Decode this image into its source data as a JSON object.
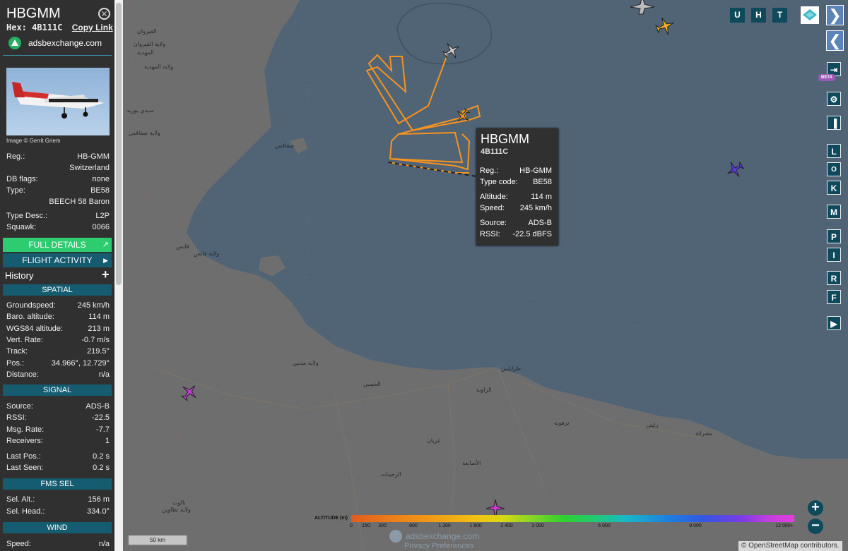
{
  "sidebar": {
    "callsign": "HBGMM",
    "close_glyph": "⨯",
    "hex_label": "Hex:",
    "hex_value": "4B111C",
    "copy_link": "Copy Link",
    "brand": "adsbexchange.com",
    "photo_credit": "Image © Gerrit Griem",
    "reg_label": "Reg.:",
    "reg_value": "HB-GMM",
    "country": "Switzerland",
    "dbflags_label": "DB flags:",
    "dbflags_value": "none",
    "type_label": "Type:",
    "type_value": "BE58",
    "type_name": "BEECH 58 Baron",
    "typedesc_label": "Type Desc.:",
    "typedesc_value": "L2P",
    "squawk_label": "Squawk:",
    "squawk_value": "0066",
    "full_details": "FULL DETAILS",
    "flight_activity": "FLIGHT ACTIVITY",
    "history": "History",
    "spatial": {
      "title": "SPATIAL",
      "rows": [
        {
          "label": "Groundspeed:",
          "value": "245 km/h"
        },
        {
          "label": "Baro. altitude:",
          "value": "114 m"
        },
        {
          "label": "WGS84 altitude:",
          "value": "213 m"
        },
        {
          "label": "Vert. Rate:",
          "value": "-0.7 m/s"
        },
        {
          "label": "Track:",
          "value": "219.5°"
        },
        {
          "label": "Pos.:",
          "value": "34.966°, 12.729°"
        },
        {
          "label": "Distance:",
          "value": "n/a"
        }
      ]
    },
    "signal": {
      "title": "SIGNAL",
      "rows": [
        {
          "label": "Source:",
          "value": "ADS-B"
        },
        {
          "label": "RSSI:",
          "value": "-22.5"
        },
        {
          "label": "Msg. Rate:",
          "value": "-7.7"
        },
        {
          "label": "Receivers:",
          "value": "1"
        },
        {
          "label": "Last Pos.:",
          "value": "0.2 s"
        },
        {
          "label": "Last Seen:",
          "value": "0.2 s"
        }
      ]
    },
    "fms": {
      "title": "FMS SEL",
      "rows": [
        {
          "label": "Sel. Alt.:",
          "value": "156 m"
        },
        {
          "label": "Sel. Head.:",
          "value": "334.0°"
        }
      ]
    },
    "wind": {
      "title": "WIND",
      "rows": [
        {
          "label": "Speed:",
          "value": "n/a"
        }
      ]
    }
  },
  "tooltip": {
    "callsign": "HBGMM",
    "hex": "4B111C",
    "rows": [
      {
        "label": "Reg.:",
        "value": "HB-GMM"
      },
      {
        "label": "Type code:",
        "value": "BE58"
      },
      {
        "label": "Altitude:",
        "value": "114 m"
      },
      {
        "label": "Speed:",
        "value": "245 km/h"
      },
      {
        "label": "Source:",
        "value": "ADS-B"
      },
      {
        "label": "RSSI:",
        "value": "-22.5 dBFS"
      }
    ]
  },
  "controls": {
    "top": [
      "U",
      "H",
      "T"
    ],
    "right": [
      "L",
      "O",
      "K",
      "M",
      "P",
      "I",
      "R",
      "F"
    ],
    "beta": "BETA"
  },
  "legend": {
    "label": "ALTITUDE (m)",
    "ticks": [
      "0",
      "150",
      "300",
      "600",
      "1 200",
      "1 800",
      "2 400",
      "3 000",
      "6 000",
      "9 000",
      "12 000+"
    ]
  },
  "map": {
    "scale": "50 km",
    "watermark": "adsbexchange.com",
    "privacy": "Privacy Preferences",
    "attribution": "© OpenStreetMap contributors.",
    "labels": [
      {
        "text": "القيروان"
      },
      {
        "text": "ولاية القيروان"
      },
      {
        "text": "المهدية"
      },
      {
        "text": "ولاية المهدية"
      },
      {
        "text": "سيدي بوزيد"
      },
      {
        "text": "ولاية صفاقس"
      },
      {
        "text": "صفاقس"
      },
      {
        "text": "قابس"
      },
      {
        "text": "ولاية قابس"
      },
      {
        "text": "ولاية مدنين"
      },
      {
        "text": "طرابلس"
      },
      {
        "text": "الزاوية"
      },
      {
        "text": "الخمس"
      },
      {
        "text": "مصراتة"
      },
      {
        "text": "غريان"
      },
      {
        "text": "ترهونة"
      },
      {
        "text": "زليتن"
      },
      {
        "text": "الأصابعة"
      },
      {
        "text": "نالوت"
      },
      {
        "text": "الرحيبات"
      },
      {
        "text": "ولاية تطاوين"
      }
    ]
  },
  "colors": {
    "track": "#f7931e",
    "sidebar_bg": "#303030",
    "section_bg": "#155c70",
    "accent_green": "#2ecc71",
    "sea": "#4f6375",
    "land": "#6e6e6e"
  }
}
